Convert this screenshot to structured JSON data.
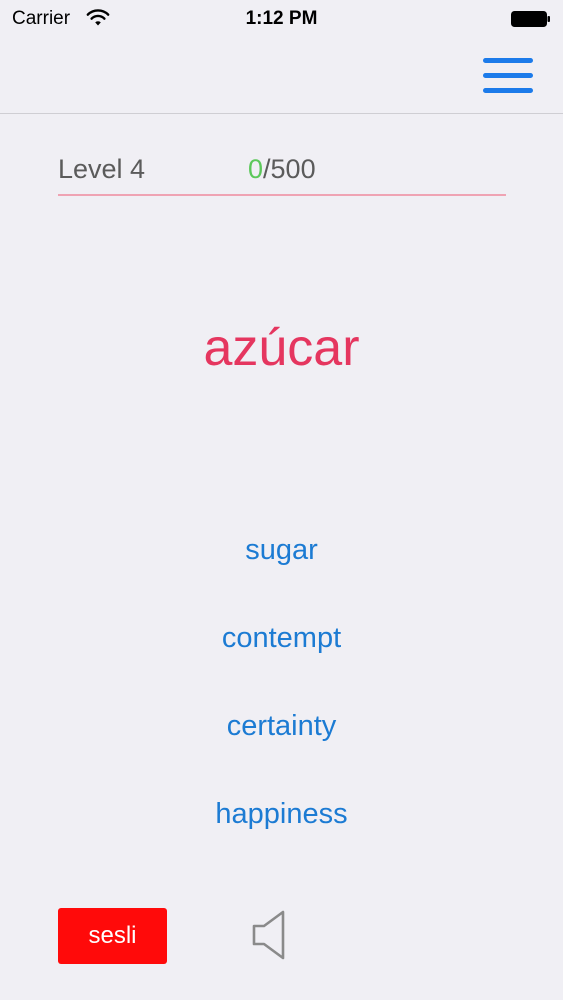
{
  "status_bar": {
    "carrier": "Carrier",
    "time": "1:12 PM",
    "wifi_icon": "wifi-icon",
    "battery_icon": "battery-icon"
  },
  "nav_bar": {
    "menu_icon": "hamburger-menu-icon",
    "accent_color": "#1C7BEA"
  },
  "level": {
    "label": "Level 4",
    "progress_done": "0",
    "progress_total": "/500",
    "progress_done_color": "#5CC85A"
  },
  "question": {
    "word": "azúcar",
    "word_color": "#E5365F"
  },
  "choices": [
    {
      "label": "sugar"
    },
    {
      "label": "contempt"
    },
    {
      "label": "certainty"
    },
    {
      "label": "happiness"
    }
  ],
  "controls": {
    "sesli_label": "sesli",
    "sesli_color": "#FF0A0A",
    "speaker_icon": "speaker-icon"
  }
}
